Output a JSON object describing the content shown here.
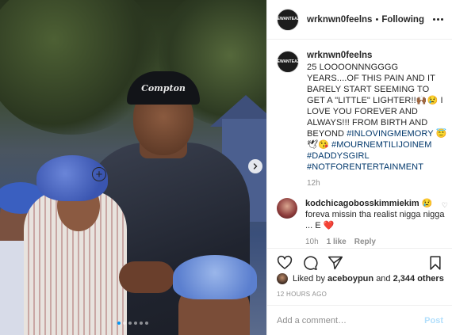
{
  "post": {
    "author": "wrknwn0feelns",
    "follow_status": "Following",
    "separator": "•",
    "avatar_text": [
      "WE",
      "WANT",
      "EAZY"
    ],
    "photo": {
      "cap_text": "Compton",
      "carousel_count": 6,
      "carousel_active": 0
    }
  },
  "caption": {
    "username": "wrknwn0feelns",
    "text": "25 LOOOONNNGGGG YEARS....OF THIS PAIN AND IT BARELY START SEEMING TO GET A \"LITTLE\" LIGHTER!!🙌🏾😢 I LOVE YOU FOREVER AND ALWAYS!!! FROM BIRTH AND BEYOND ",
    "hashtags": [
      "#INLOVINGMEMORY",
      "😇",
      "🕊",
      "😘",
      "#MOURNEMTILIJOINEM",
      "#DADDYSGIRL",
      "#NOTFORENTERTAINMENT"
    ],
    "time": "12h"
  },
  "comment": {
    "username": "kodchicagobosskimmiekim",
    "emoji": "😢",
    "text": "foreva missin tha realist nigga nigga ... E",
    "heart": "❤️",
    "time": "10h",
    "likes": "1 like",
    "reply_label": "Reply"
  },
  "likes": {
    "prefix": "Liked by",
    "user": "aceboypun",
    "joiner": "and",
    "others": "2,344 others"
  },
  "timestamp": "12 HOURS AGO",
  "add_comment": {
    "placeholder": "Add a comment…",
    "post_label": "Post"
  },
  "colors": {
    "link": "#00376b",
    "secondary": "#8e8e8e",
    "post_disabled": "#b2dffc",
    "carousel_active": "#0095f6"
  },
  "icons": [
    "more-icon",
    "next-arrow-icon",
    "load-more-icon",
    "heart-icon",
    "comment-icon",
    "share-icon",
    "bookmark-icon",
    "small-heart-icon"
  ]
}
